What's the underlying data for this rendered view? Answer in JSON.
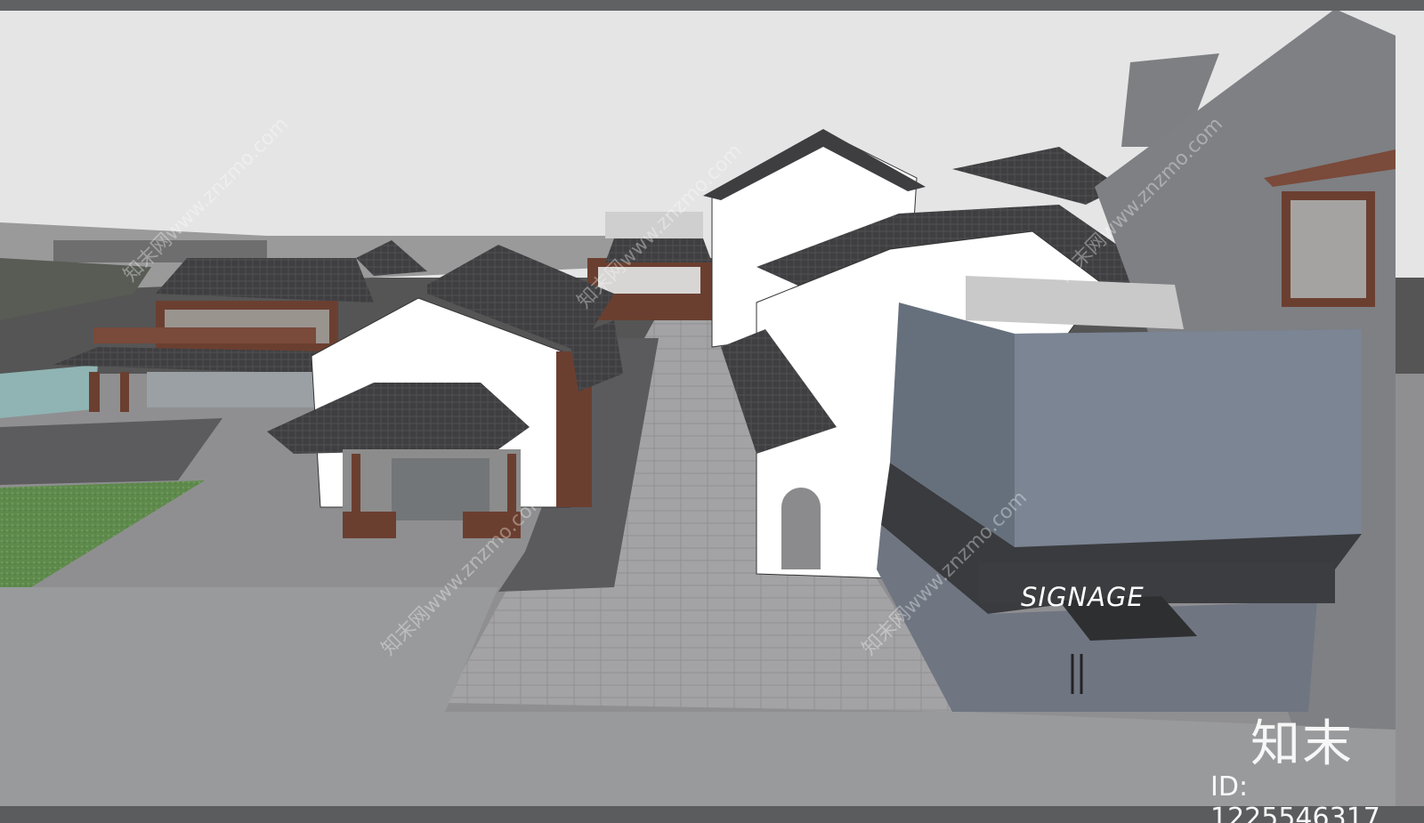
{
  "scene": {
    "storefront_sign": "SIGNAGE",
    "sky_color": "#e6e6e6",
    "roof_color": "#3e3e40",
    "wall_color": "#ffffff",
    "timber_color": "#6b3f30",
    "pavement_color": "#8c8c8e",
    "lawn_color": "#5f8a4d",
    "water_color": "#8fb4b3",
    "glass_color": "#66707d"
  },
  "overlay": {
    "logo": "知末",
    "image_id": "ID: 1225546317",
    "watermark": "知末网www.znzmo.com"
  }
}
